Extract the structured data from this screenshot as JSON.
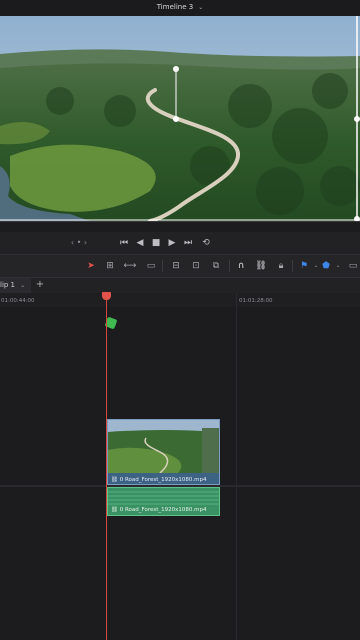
{
  "header": {
    "title": "Timeline 3",
    "chevron_icon": "chevron-down-icon"
  },
  "viewer": {
    "scene": "aerial-forest-road",
    "sky_color": "#9db8d4",
    "forest_color": "#2f5a2a",
    "road_color": "#cfc7b4",
    "water_color": "#5a7a8c",
    "transform_handles_color": "#ffffff"
  },
  "transport": {
    "prev_indicator": "‹ • ›",
    "icons": [
      "skip-to-start-icon",
      "step-back-icon",
      "stop-icon",
      "play-icon",
      "skip-to-end-icon",
      "loop-icon"
    ]
  },
  "toolbar": {
    "accent": "#3d86e6",
    "selection_color": "#e0524a",
    "icons": [
      "select-icon",
      "trim-icon",
      "dynamic-trim-icon",
      "blade-icon",
      "insert-icon",
      "overwrite-icon",
      "replace-icon",
      "snapping-icon",
      "link-icon",
      "lock-icon",
      "flag-icon",
      "marker-icon",
      "zoom-icon"
    ]
  },
  "tabs": {
    "current_label": "lip 1",
    "add_label": "+"
  },
  "ruler": {
    "tc_left": "01:00:44:00",
    "tc_right": "01:01:28:00"
  },
  "clips": {
    "video": {
      "label": "0 Road_Forest_1920x1080.mp4",
      "color": "#3d6384"
    },
    "audio": {
      "label": "0 Road_Forest_1920x1080.mp4",
      "color": "#3a9163"
    }
  },
  "playhead": {
    "color": "#e0524a"
  },
  "marker": {
    "color": "#3fb950"
  }
}
